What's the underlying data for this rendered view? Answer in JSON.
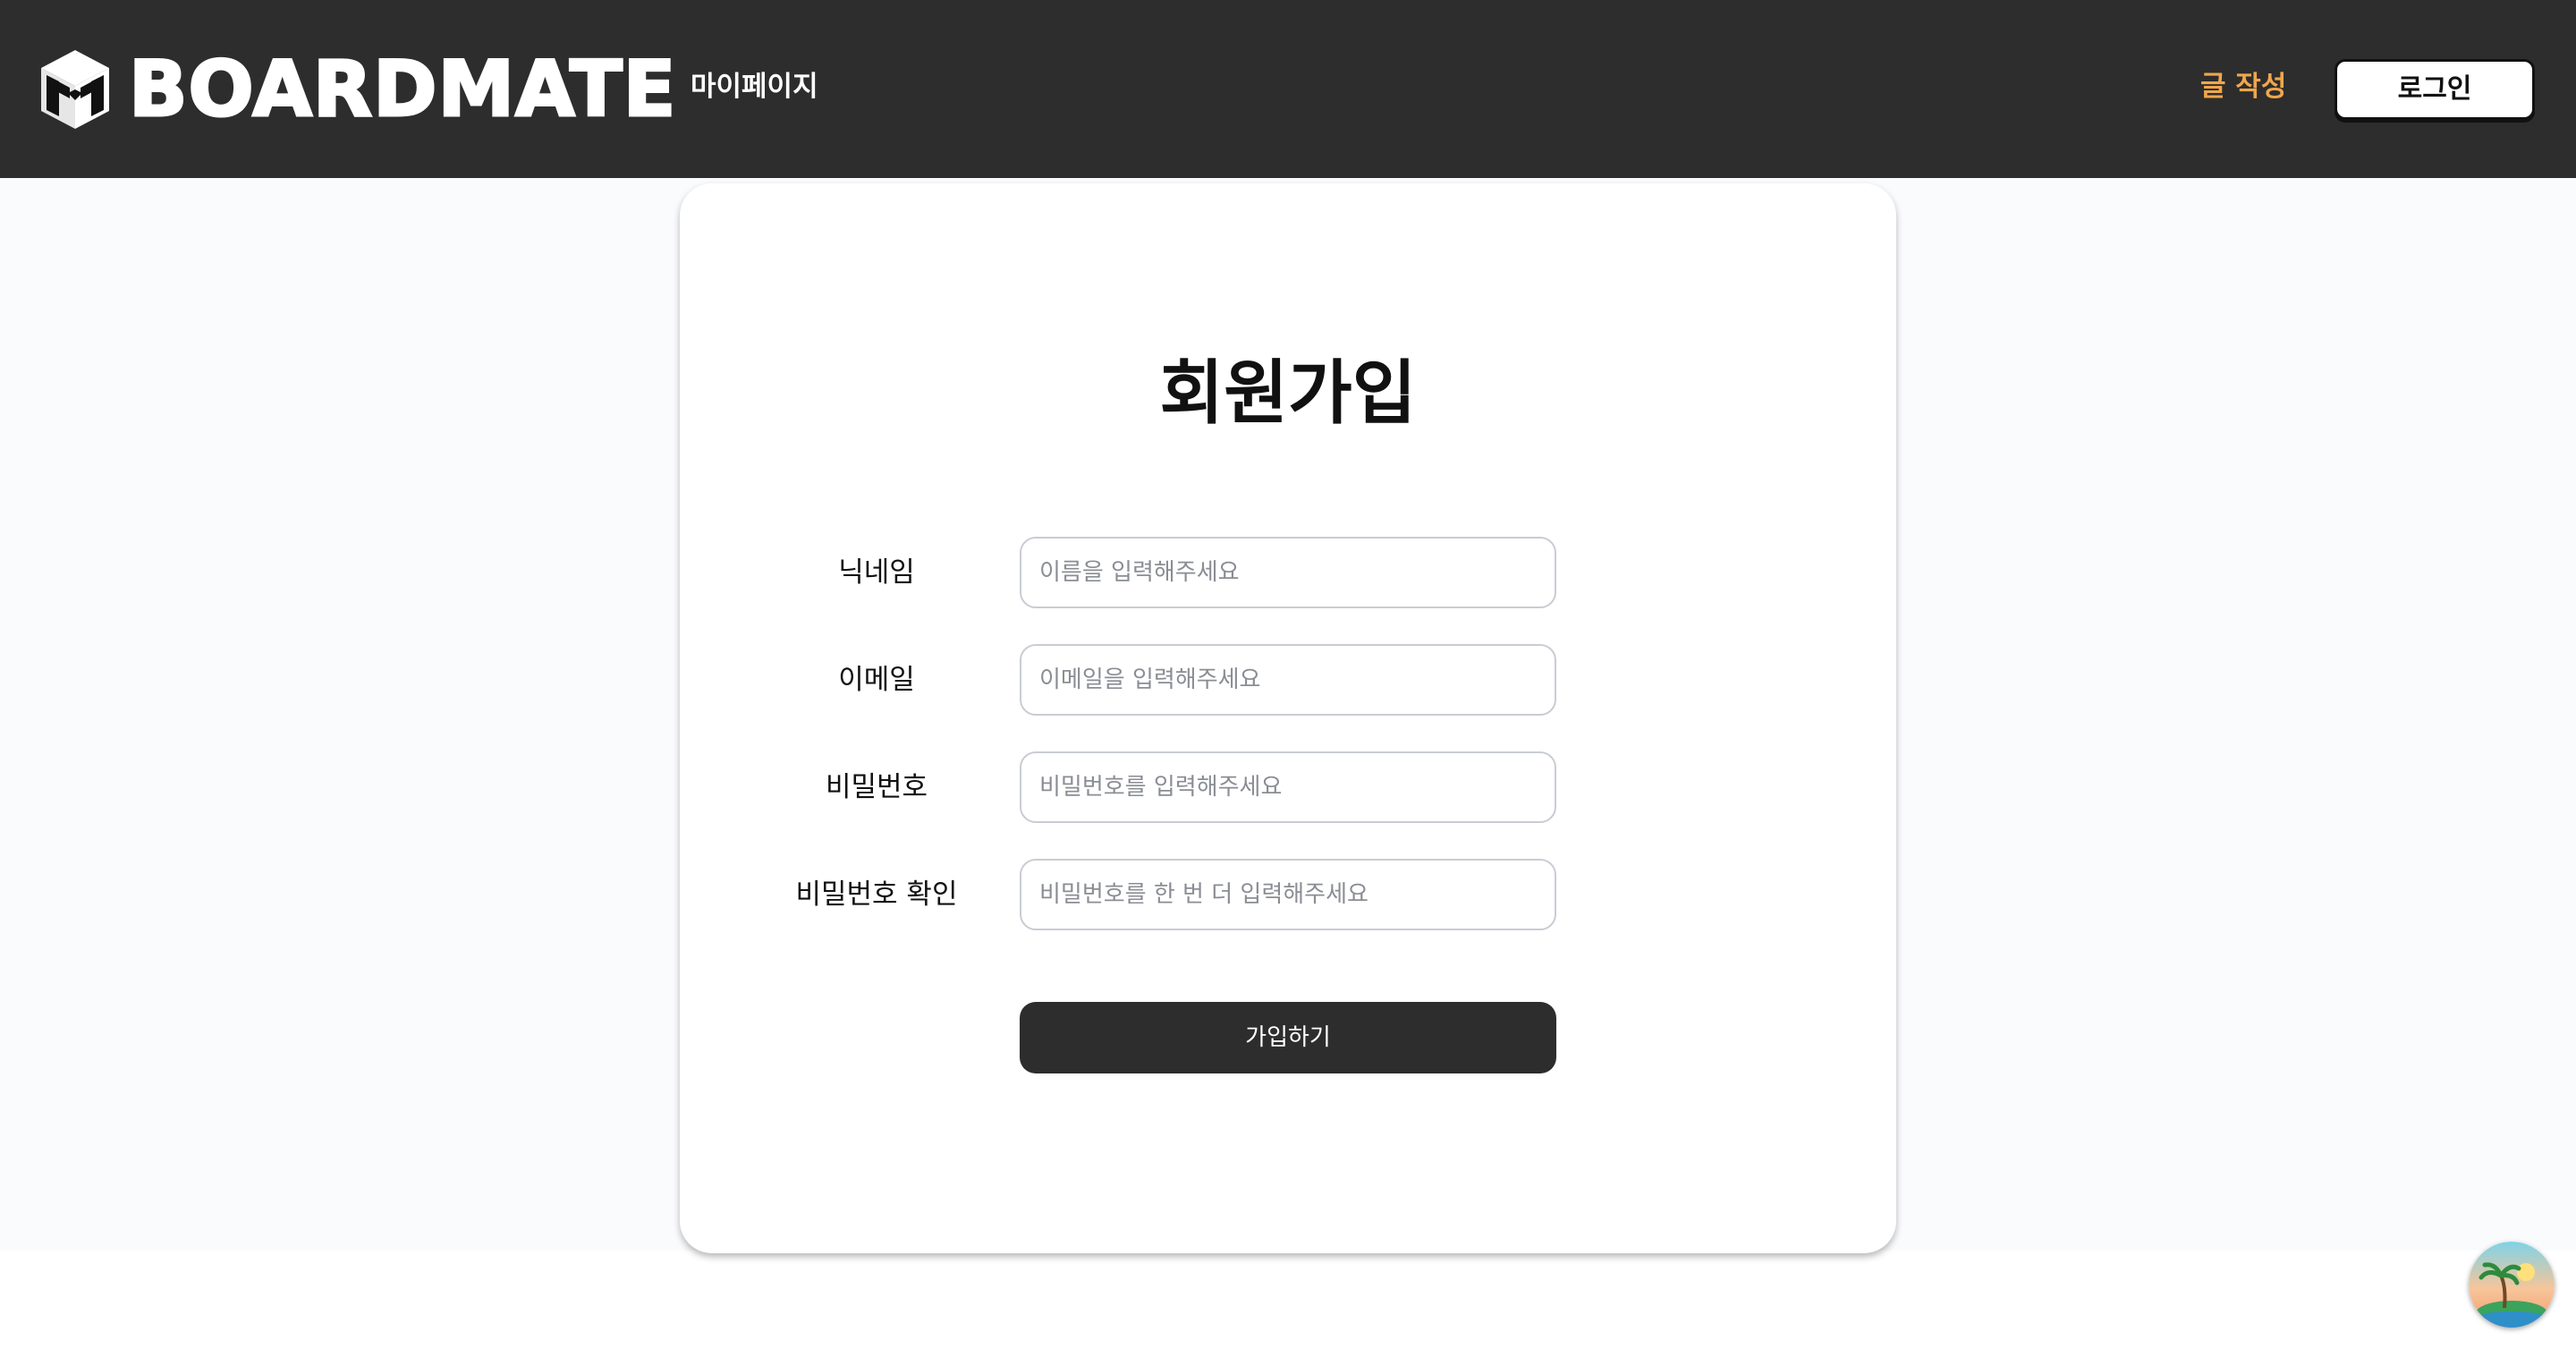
{
  "header": {
    "logo_text": "BOARDMATE",
    "nav_mypage": "마이페이지",
    "nav_write": "글 작성",
    "login_label": "로그인"
  },
  "signup": {
    "title": "회원가입",
    "fields": [
      {
        "label": "닉네임",
        "placeholder": "이름을 입력해주세요"
      },
      {
        "label": "이메일",
        "placeholder": "이메일을 입력해주세요"
      },
      {
        "label": "비밀번호",
        "placeholder": "비밀번호를 입력해주세요"
      },
      {
        "label": "비밀번호 확인",
        "placeholder": "비밀번호를 한 번 더 입력해주세요"
      }
    ],
    "submit_label": "가입하기"
  },
  "colors": {
    "header_bg": "#2d2d2d",
    "accent": "#f0a64c",
    "button_dark": "#2d2d2d"
  },
  "icons": {
    "logo": "cube-icon",
    "floating": "island-avatar-icon"
  }
}
